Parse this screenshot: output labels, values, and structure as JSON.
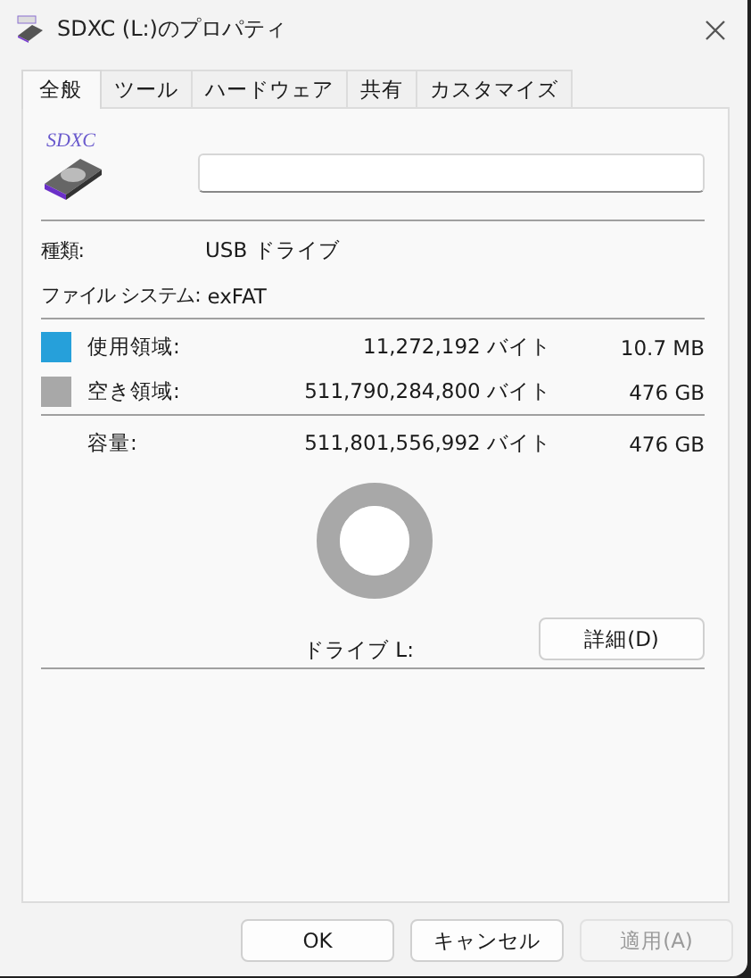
{
  "window": {
    "title": "SDXC (L:)のプロパティ"
  },
  "tabs": [
    {
      "label": "全般",
      "selected": true
    },
    {
      "label": "ツール",
      "selected": false
    },
    {
      "label": "ハードウェア",
      "selected": false
    },
    {
      "label": "共有",
      "selected": false
    },
    {
      "label": "カスタマイズ",
      "selected": false
    }
  ],
  "drive": {
    "icon_label": "SDXC"
  },
  "info": [
    {
      "label": "種類:",
      "value": "USB ドライブ"
    },
    {
      "label": "ファイル システム:",
      "value": "exFAT"
    }
  ],
  "space": [
    {
      "label": "使用領域:",
      "bytes": "11,272,192 バイト",
      "size": "10.7 MB",
      "color": "#26a0da"
    },
    {
      "label": "空き領域:",
      "bytes": "511,790,284,800 バイト",
      "size": "476 GB",
      "color": "#a8a8a8"
    }
  ],
  "capacity": {
    "label": "容量:",
    "bytes": "511,801,556,992 バイト",
    "size": "476 GB"
  },
  "drive_label": "ドライブ L:",
  "details_button": "詳細(D)",
  "buttons": [
    {
      "label": "OK",
      "disabled": false
    },
    {
      "label": "キャンセル",
      "disabled": false
    },
    {
      "label": "適用(A)",
      "disabled": true
    }
  ]
}
